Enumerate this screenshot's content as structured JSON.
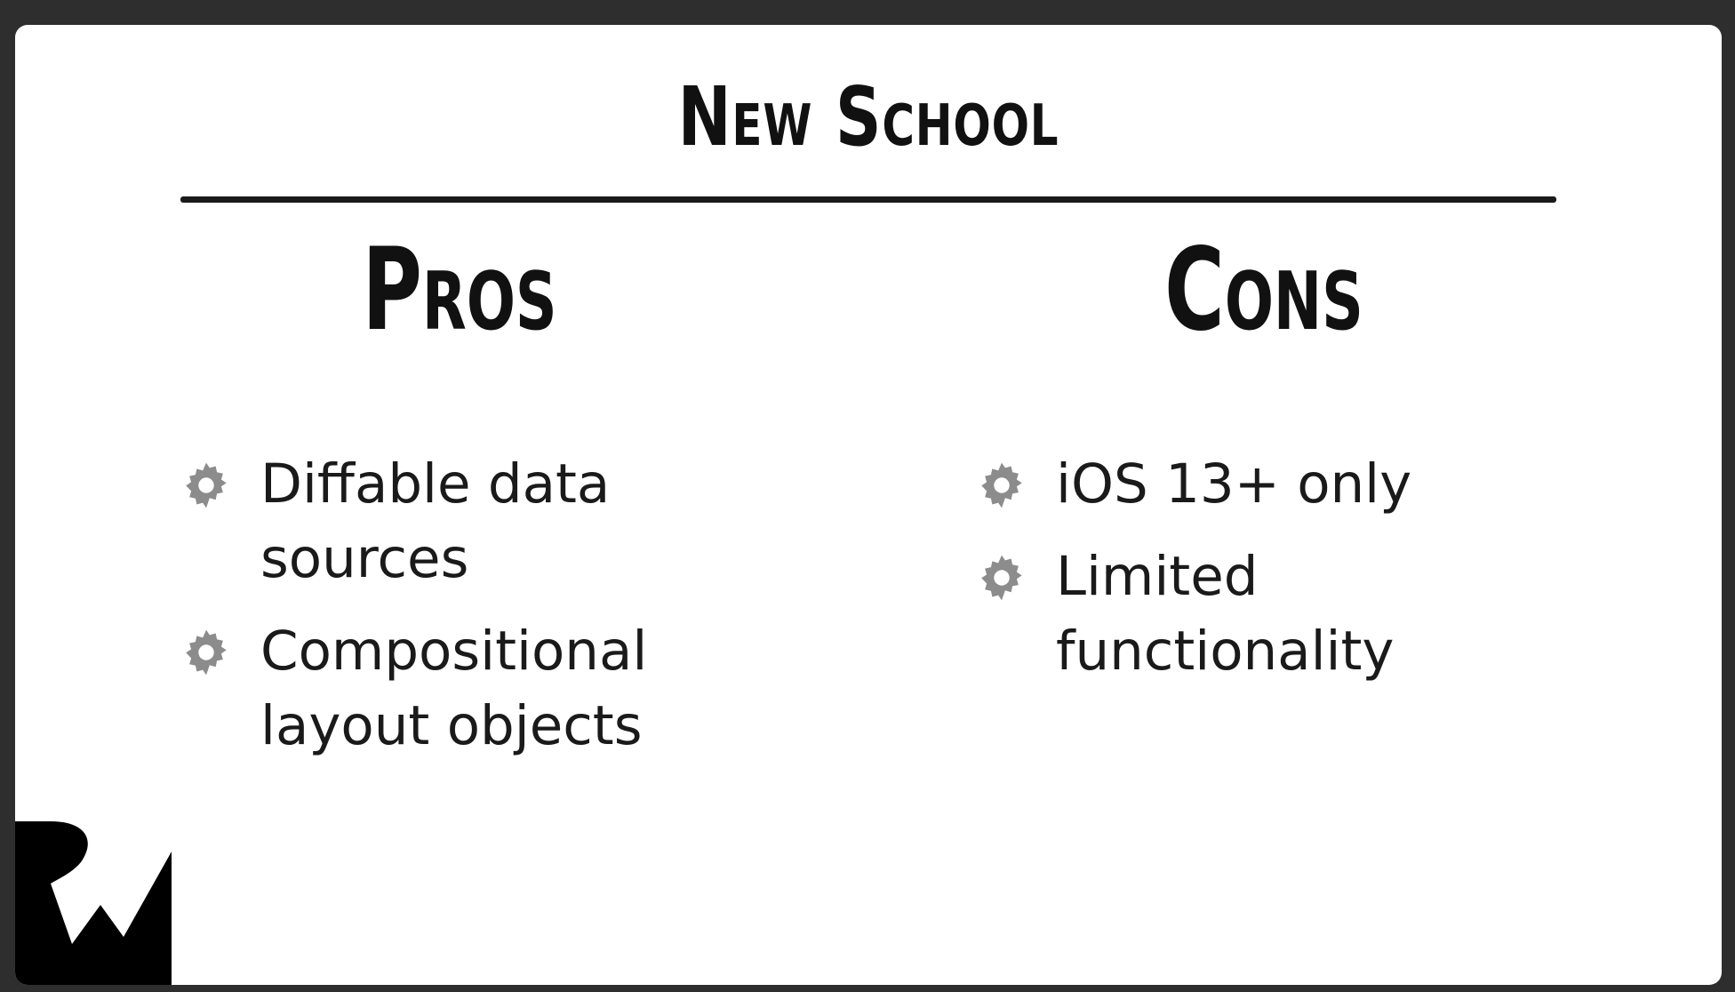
{
  "slide": {
    "title": "New School",
    "pros": {
      "heading": "Pros",
      "items": [
        {
          "text": "Diffable data sources",
          "icon": "gear-icon"
        },
        {
          "text": "Compositional layout objects",
          "icon": "gear-icon"
        }
      ]
    },
    "cons": {
      "heading": "Cons",
      "items": [
        {
          "text": "iOS 13+ only",
          "icon": "gear-icon"
        },
        {
          "text": "Limited functionality",
          "icon": "gear-icon"
        }
      ]
    },
    "logo_icon": "raywenderlich-logo-icon"
  },
  "colors": {
    "background": "#2e2e2e",
    "slide": "#ffffff",
    "text": "#1a1a1a",
    "bullet_gear": "#8c8c8c",
    "logo": "#000000"
  }
}
